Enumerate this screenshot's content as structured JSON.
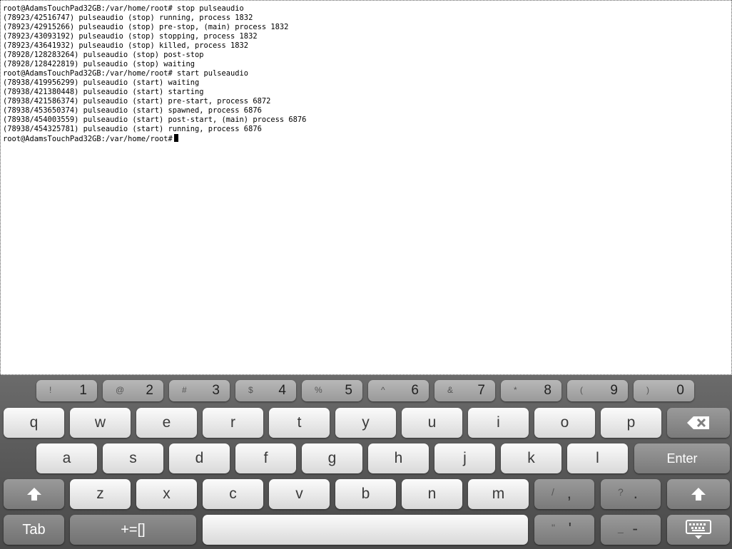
{
  "terminal": {
    "lines": [
      "root@AdamsTouchPad32GB:/var/home/root# stop pulseaudio",
      "(78923/42516747) pulseaudio (stop) running, process 1832",
      "(78923/42915266) pulseaudio (stop) pre-stop, (main) process 1832",
      "(78923/43093192) pulseaudio (stop) stopping, process 1832",
      "(78923/43641932) pulseaudio (stop) killed, process 1832",
      "(78928/128283264) pulseaudio (stop) post-stop",
      "(78928/128422819) pulseaudio (stop) waiting",
      "root@AdamsTouchPad32GB:/var/home/root# start pulseaudio",
      "(78938/419956299) pulseaudio (start) waiting",
      "(78938/421380448) pulseaudio (start) starting",
      "(78938/421586374) pulseaudio (start) pre-start, process 6872",
      "(78938/453650374) pulseaudio (start) spawned, process 6876",
      "(78938/454003559) pulseaudio (start) post-start, (main) process 6876",
      "(78938/454325781) pulseaudio (start) running, process 6876"
    ],
    "prompt": "root@AdamsTouchPad32GB:/var/home/root#"
  },
  "keyboard": {
    "number_row": [
      {
        "shift": "!",
        "main": "1"
      },
      {
        "shift": "@",
        "main": "2"
      },
      {
        "shift": "#",
        "main": "3"
      },
      {
        "shift": "$",
        "main": "4"
      },
      {
        "shift": "%",
        "main": "5"
      },
      {
        "shift": "^",
        "main": "6"
      },
      {
        "shift": "&",
        "main": "7"
      },
      {
        "shift": "*",
        "main": "8"
      },
      {
        "shift": "(",
        "main": "9"
      },
      {
        "shift": ")",
        "main": "0"
      }
    ],
    "row1": [
      "q",
      "w",
      "e",
      "r",
      "t",
      "y",
      "u",
      "i",
      "o",
      "p"
    ],
    "row2": [
      "a",
      "s",
      "d",
      "f",
      "g",
      "h",
      "j",
      "k",
      "l"
    ],
    "row3": [
      "z",
      "x",
      "c",
      "v",
      "b",
      "n",
      "m"
    ],
    "slash_comma": {
      "shift": "/",
      "main": ","
    },
    "question_period": {
      "shift": "?",
      "main": "."
    },
    "quote_apostrophe": {
      "shift": "\"",
      "main": "'"
    },
    "underscore_dash": {
      "shift": "_",
      "main": "-"
    },
    "enter_label": "Enter",
    "tab_label": "Tab",
    "symbols_label": "+=[]"
  }
}
